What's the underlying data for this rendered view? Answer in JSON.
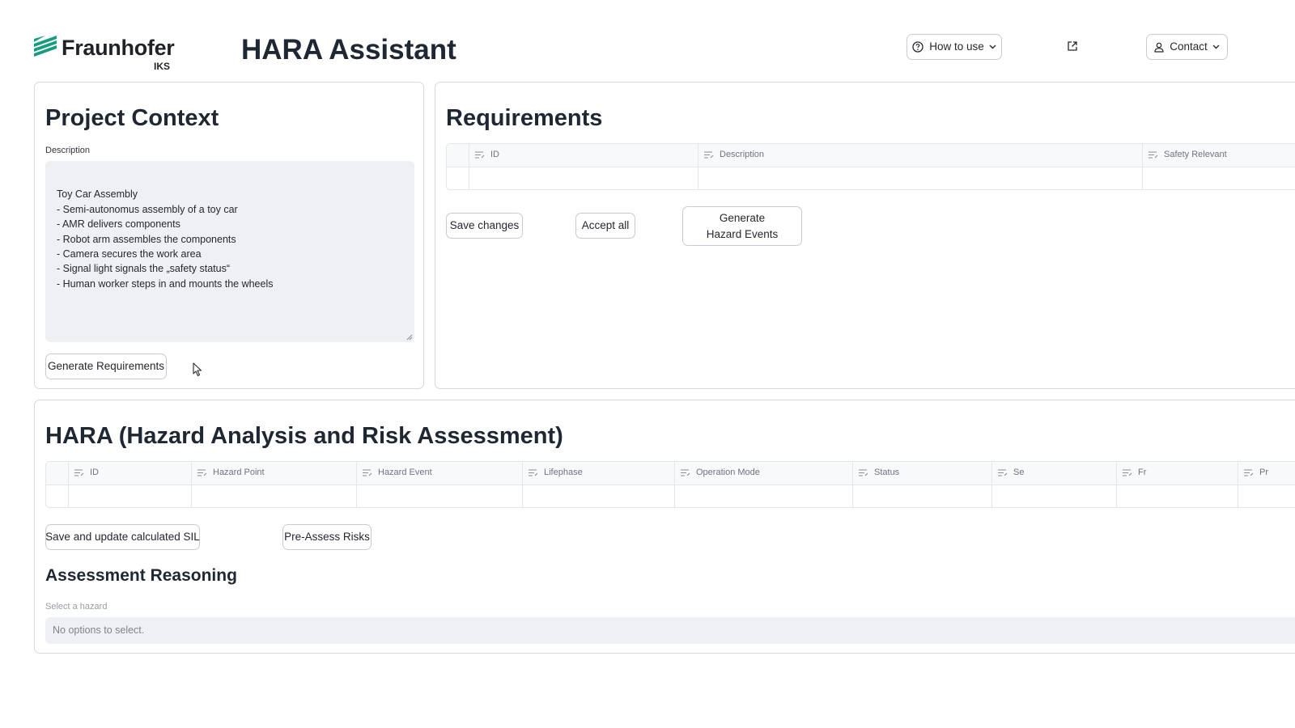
{
  "header": {
    "logo_name": "Fraunhofer",
    "logo_sub": "IKS",
    "app_title": "HARA Assistant",
    "how_to_use": "How to use",
    "contact": "Contact",
    "icons": {
      "help": "help-circle-icon",
      "external": "external-link-icon",
      "user": "user-icon",
      "chevron": "chevron-down-icon"
    },
    "brand_color": "#179c7d"
  },
  "project_context": {
    "title": "Project Context",
    "description_label": "Description",
    "description_value": "Toy Car Assembly\n- Semi-autonomus assembly of a toy car\n- AMR delivers components\n- Robot arm assembles the components\n- Camera secures the work area\n- Signal light signals the „safety status“\n- Human worker steps in and mounts the wheels",
    "generate_button": "Generate Requirements"
  },
  "requirements": {
    "title": "Requirements",
    "columns": [
      "ID",
      "Description",
      "Safety Relevant"
    ],
    "save_button": "Save changes",
    "accept_button": "Accept all",
    "generate_button": "Generate Hazard Events"
  },
  "hara": {
    "title": "HARA (Hazard Analysis and Risk Assessment)",
    "columns": [
      "ID",
      "Hazard Point",
      "Hazard Event",
      "Lifephase",
      "Operation Mode",
      "Status",
      "Se",
      "Fr",
      "Pr"
    ],
    "save_button": "Save and update calculated SIL",
    "preassess_button": "Pre-Assess Risks",
    "reasoning_title": "Assessment Reasoning",
    "select_label": "Select a hazard",
    "select_placeholder": "No options to select."
  }
}
